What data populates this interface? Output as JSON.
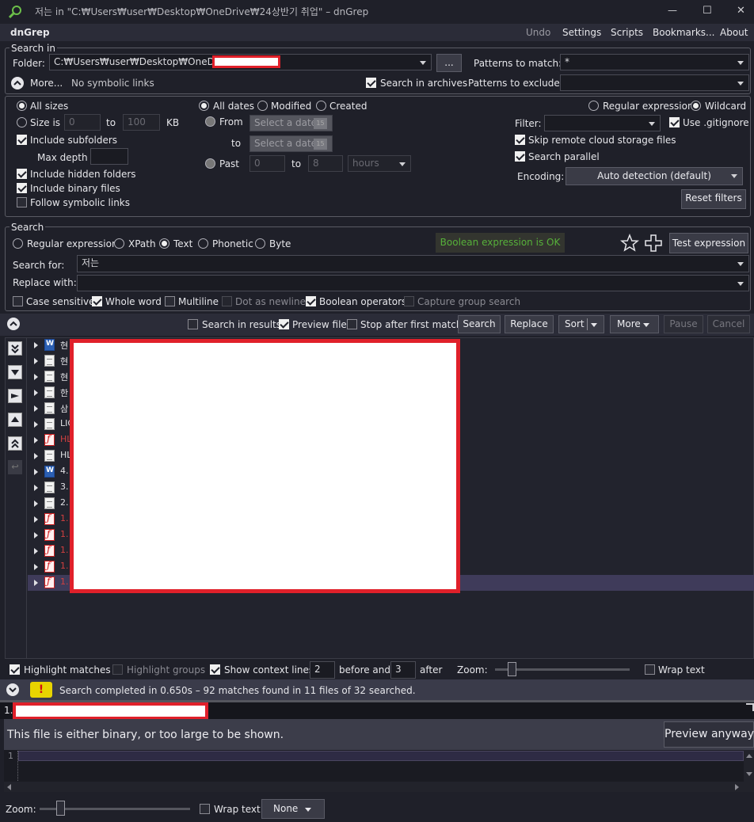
{
  "window": {
    "title": "저는 in \"C:₩Users₩user₩Desktop₩OneDrive₩24상반기 취업\" – dnGrep",
    "minimize": "—",
    "maximize": "☐",
    "close": "✕"
  },
  "menu": {
    "app": "dnGrep",
    "undo": "Undo",
    "settings": "Settings",
    "scripts": "Scripts",
    "bookmarks": "Bookmarks...",
    "about": "About"
  },
  "search_in": {
    "legend": "Search in",
    "folder_label": "Folder:",
    "folder_value": "C:₩Users₩user₩Desktop₩OneDrive₩",
    "browse": "...",
    "patterns_match_label": "Patterns to match:",
    "patterns_match_value": "*",
    "more": "More...",
    "no_symbolic": "No symbolic links",
    "search_archives": "Search in archives",
    "patterns_exclude_label": "Patterns to exclude:",
    "patterns_exclude_value": ""
  },
  "filters": {
    "all_sizes": "All sizes",
    "size_is": "Size is",
    "size_from": "0",
    "size_to_label": "to",
    "size_to": "100",
    "size_unit": "KB",
    "include_subfolders": "Include subfolders",
    "max_depth": "Max depth",
    "include_hidden": "Include hidden folders",
    "include_binary": "Include binary files",
    "follow_symbolic": "Follow symbolic links",
    "all_dates": "All dates",
    "modified": "Modified",
    "created": "Created",
    "from": "From",
    "date_placeholder": "Select a date",
    "to": "to",
    "past": "Past",
    "past_from": "0",
    "past_to_label": "to",
    "past_to": "8",
    "past_unit": "hours",
    "regex": "Regular expression",
    "wildcard": "Wildcard",
    "filter_label": "Filter:",
    "filter_value": "",
    "use_gitignore": "Use .gitignore",
    "skip_cloud": "Skip remote cloud storage files",
    "search_parallel": "Search parallel",
    "encoding_label": "Encoding:",
    "encoding_value": "Auto detection (default)",
    "reset_filters": "Reset filters",
    "calendar_icon": "15"
  },
  "search": {
    "legend": "Search",
    "regex": "Regular expression",
    "xpath": "XPath",
    "text": "Text",
    "phonetic": "Phonetic",
    "byte": "Byte",
    "boolean_ok": "Boolean expression is OK",
    "test_expression": "Test expression",
    "search_for_label": "Search for:",
    "search_for_value": "저는",
    "replace_label": "Replace with:",
    "replace_value": "",
    "case_sensitive": "Case sensitive",
    "whole_word": "Whole word",
    "multiline": "Multiline",
    "dot_newline": "Dot as newline",
    "boolean_ops": "Boolean operators",
    "capture_group": "Capture group search"
  },
  "actions": {
    "search_in_results": "Search in results",
    "preview_file": "Preview file",
    "stop_first": "Stop after first match",
    "search": "Search",
    "replace": "Replace",
    "sort": "Sort",
    "more": "More",
    "pause": "Pause",
    "cancel": "Cancel"
  },
  "results": {
    "files": [
      {
        "name": "현",
        "type": "word"
      },
      {
        "name": "현",
        "type": "txt"
      },
      {
        "name": "현",
        "type": "txt"
      },
      {
        "name": "한",
        "type": "txt"
      },
      {
        "name": "삼",
        "type": "txt"
      },
      {
        "name": "LIC",
        "type": "txt"
      },
      {
        "name": "HL",
        "type": "pdf"
      },
      {
        "name": "HL",
        "type": "txt"
      },
      {
        "name": "4.",
        "type": "word"
      },
      {
        "name": "3.",
        "type": "txt"
      },
      {
        "name": "2.",
        "type": "txt"
      },
      {
        "name": "1.",
        "type": "pdf"
      },
      {
        "name": "1.",
        "type": "pdf"
      },
      {
        "name": "1.",
        "type": "pdf"
      },
      {
        "name": "1.",
        "type": "pdf"
      },
      {
        "name": "1.",
        "type": "pdf"
      }
    ]
  },
  "options": {
    "highlight_matches": "Highlight matches",
    "highlight_groups": "Highlight groups",
    "show_context": "Show context lines",
    "before_value": "2",
    "before_label": "before and",
    "after_value": "3",
    "after_label": "after",
    "zoom": "Zoom:",
    "wrap_text": "Wrap text"
  },
  "status": {
    "warn_icon": "!",
    "message": "Search completed in 0.650s – 92 matches found in 11 files of 32 searched."
  },
  "preview": {
    "file_prefix": "1.",
    "notice": "This file is either binary, or too large to be shown.",
    "preview_anyway": "Preview anyway",
    "line_no": "1",
    "zoom": "Zoom:",
    "wrap_text": "Wrap text",
    "syntax": "None"
  }
}
